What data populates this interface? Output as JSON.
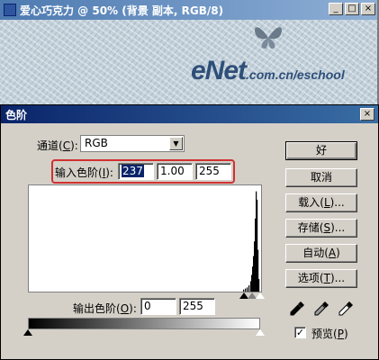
{
  "document_window": {
    "title": "爱心巧克力 @ 50% (背景 副本, RGB/8)",
    "watermark_brand": "eNet",
    "watermark_url": ".com.cn/eschool",
    "controls": [
      "_",
      "□",
      "×"
    ]
  },
  "dialog": {
    "title": "色阶",
    "close_label": "×",
    "channel": {
      "label": "通道(",
      "mnemonic": "C",
      "label_end": "):",
      "value": "RGB"
    },
    "input_levels": {
      "label": "输入色阶(",
      "mnemonic": "I",
      "label_end": "):",
      "black": "237",
      "gamma": "1.00",
      "white": "255"
    },
    "output_levels": {
      "label": "输出色阶(",
      "mnemonic": "O",
      "label_end": "):",
      "black": "0",
      "white": "255"
    },
    "buttons": {
      "ok": "好",
      "cancel": "取消",
      "load_prefix": "载入(",
      "load_mnemonic": "L",
      "load_suffix": ")...",
      "save_prefix": "存储(",
      "save_mnemonic": "S",
      "save_suffix": ")...",
      "auto_prefix": "自动(",
      "auto_mnemonic": "A",
      "auto_suffix": ")",
      "options_prefix": "选项(",
      "options_mnemonic": "T",
      "options_suffix": ")..."
    },
    "preview": {
      "label_prefix": "预览(",
      "mnemonic": "P",
      "label_suffix": ")",
      "checked": true,
      "check_glyph": "✓"
    },
    "eyedroppers": [
      "black-eyedropper-icon",
      "gray-eyedropper-icon",
      "white-eyedropper-icon"
    ],
    "input_sliders": {
      "black": 237,
      "gamma": 1.0,
      "white": 255
    },
    "output_sliders": {
      "black": 0,
      "white": 255
    }
  },
  "histogram": {
    "range": [
      0,
      255
    ],
    "bins": [
      {
        "level": 238,
        "count": 2
      },
      {
        "level": 240,
        "count": 3
      },
      {
        "level": 242,
        "count": 4
      },
      {
        "level": 244,
        "count": 6
      },
      {
        "level": 246,
        "count": 10
      },
      {
        "level": 247,
        "count": 16
      },
      {
        "level": 248,
        "count": 24
      },
      {
        "level": 249,
        "count": 34
      },
      {
        "level": 250,
        "count": 48
      },
      {
        "level": 251,
        "count": 70
      },
      {
        "level": 252,
        "count": 96
      },
      {
        "level": 253,
        "count": 88
      },
      {
        "level": 254,
        "count": 40
      },
      {
        "level": 255,
        "count": 12
      }
    ],
    "max_count": 100
  }
}
